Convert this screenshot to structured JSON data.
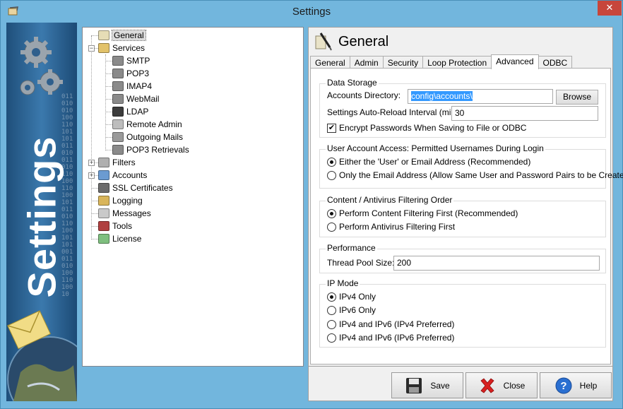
{
  "window": {
    "title": "Settings",
    "close": "✕"
  },
  "banner": {
    "text": "Settings",
    "binary": "01101001010011010110101101001101011010011010010101101011010010110100101101010011010010"
  },
  "tree": [
    {
      "label": "General",
      "level": 0,
      "selected": true,
      "icon": "general-icon"
    },
    {
      "label": "Services",
      "level": 0,
      "expanded": true,
      "icon": "services-icon"
    },
    {
      "label": "SMTP",
      "level": 1,
      "icon": "smtp-icon"
    },
    {
      "label": "POP3",
      "level": 1,
      "icon": "pop3-icon"
    },
    {
      "label": "IMAP4",
      "level": 1,
      "icon": "imap4-icon"
    },
    {
      "label": "WebMail",
      "level": 1,
      "icon": "webmail-icon"
    },
    {
      "label": "LDAP",
      "level": 1,
      "icon": "ldap-icon"
    },
    {
      "label": "Remote Admin",
      "level": 1,
      "icon": "remote-admin-icon"
    },
    {
      "label": "Outgoing Mails",
      "level": 1,
      "icon": "outgoing-mails-icon"
    },
    {
      "label": "POP3 Retrievals",
      "level": 1,
      "icon": "pop3-retrievals-icon"
    },
    {
      "label": "Filters",
      "level": 0,
      "collapsed": true,
      "icon": "filters-icon"
    },
    {
      "label": "Accounts",
      "level": 0,
      "collapsed": true,
      "icon": "accounts-icon"
    },
    {
      "label": "SSL Certificates",
      "level": 0,
      "icon": "ssl-certificates-icon"
    },
    {
      "label": "Logging",
      "level": 0,
      "icon": "logging-icon"
    },
    {
      "label": "Messages",
      "level": 0,
      "icon": "messages-icon"
    },
    {
      "label": "Tools",
      "level": 0,
      "icon": "tools-icon"
    },
    {
      "label": "License",
      "level": 0,
      "icon": "license-icon"
    }
  ],
  "page": {
    "title": "General",
    "icon": "pen-icon"
  },
  "tabs": [
    {
      "label": "General",
      "active": false
    },
    {
      "label": "Admin",
      "active": false
    },
    {
      "label": "Security",
      "active": false
    },
    {
      "label": "Loop Protection",
      "active": false
    },
    {
      "label": "Advanced",
      "active": true
    },
    {
      "label": "ODBC",
      "active": false
    }
  ],
  "data_storage": {
    "title": "Data Storage",
    "accounts_dir_label": "Accounts Directory:",
    "accounts_dir_value": "config\\accounts\\",
    "browse": "Browse",
    "reload_label": "Settings Auto-Reload Interval (mins):",
    "reload_value": "30",
    "encrypt_label": "Encrypt Passwords When Saving to File or ODBC",
    "encrypt_checked": true
  },
  "user_access": {
    "title": "User Account Access: Permitted Usernames During Login",
    "options": [
      {
        "label": "Either the 'User' or Email Address (Recommended)",
        "selected": true
      },
      {
        "label": "Only the Email Address (Allow Same User and Password Pairs to be Created)",
        "selected": false
      }
    ]
  },
  "filtering": {
    "title": "Content / Antivirus Filtering Order",
    "options": [
      {
        "label": "Perform Content Filtering First (Recommended)",
        "selected": true
      },
      {
        "label": "Perform Antivirus Filtering First",
        "selected": false
      }
    ]
  },
  "performance": {
    "title": "Performance",
    "thread_label": "Thread Pool Size:",
    "thread_value": "200"
  },
  "ip_mode": {
    "title": "IP Mode",
    "options": [
      {
        "label": "IPv4 Only",
        "selected": true
      },
      {
        "label": "IPv6 Only",
        "selected": false
      },
      {
        "label": "IPv4 and IPv6 (IPv4 Preferred)",
        "selected": false
      },
      {
        "label": "IPv4 and IPv6 (IPv6 Preferred)",
        "selected": false
      }
    ]
  },
  "buttons": {
    "save": "Save",
    "close": "Close",
    "help": "Help"
  }
}
